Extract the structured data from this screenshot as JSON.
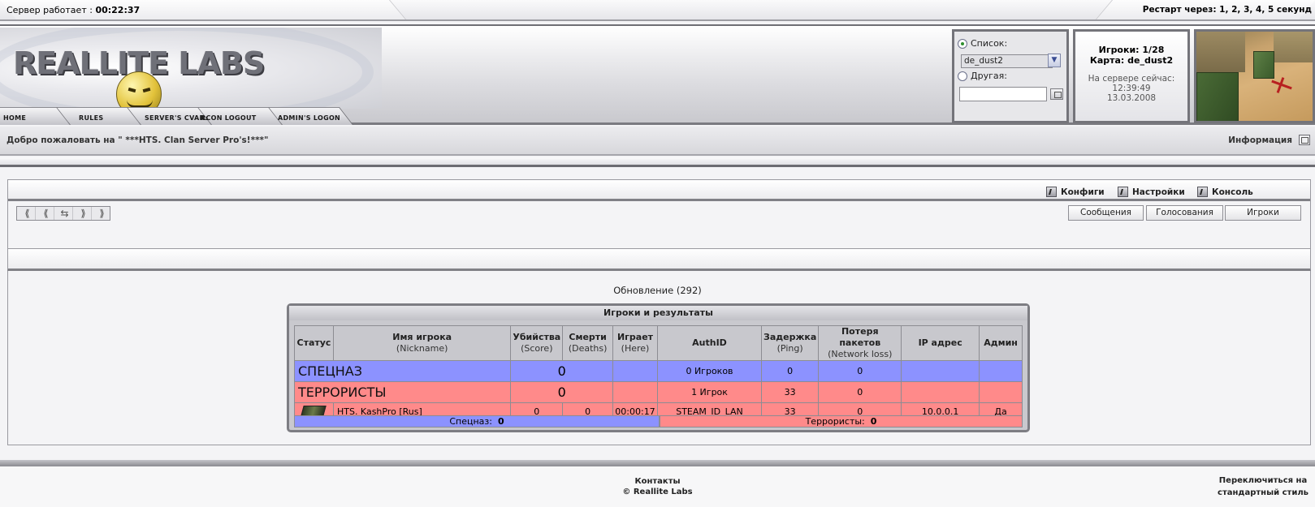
{
  "topbar": {
    "uptime_label": "Сервер работает :",
    "uptime_value": "00:22:37",
    "restart": "Рестарт через: 1, 2, 3, 4, 5 секунд"
  },
  "logo": {
    "text": "REALLITE LABS"
  },
  "nav": {
    "items": [
      "HOME",
      "RULES",
      "SERVER'S CVARS",
      "RCON LOGOUT",
      "ADMIN'S LOGON"
    ]
  },
  "mapbox": {
    "list_label": "Список:",
    "selected_map": "de_dust2",
    "other_label": "Другая:",
    "other_value": ""
  },
  "server_info": {
    "players": "Игроки: 1/28",
    "map": "Карта: de_dust2",
    "now_label": "На сервере сейчас:",
    "time": "12:39:49",
    "date": "13.03.2008"
  },
  "welcome": {
    "message": "Добро пожаловать на \" ***HTS. Clan Server Pro's!***\"",
    "info": "Информация"
  },
  "toolbar": {
    "configs": "Конфиги",
    "settings": "Настройки",
    "console": "Консоль"
  },
  "tabs": [
    "Сообщения",
    "Голосования",
    "Игроки"
  ],
  "update": "Обновление (292)",
  "players_table": {
    "caption": "Игроки и результаты",
    "headers": [
      {
        "main": "Статус",
        "sub": ""
      },
      {
        "main": "Имя игрока",
        "sub": "(Nickname)"
      },
      {
        "main": "Убийства",
        "sub": "(Score)"
      },
      {
        "main": "Смерти",
        "sub": "(Deaths)"
      },
      {
        "main": "Играет",
        "sub": "(Here)"
      },
      {
        "main": "AuthID",
        "sub": ""
      },
      {
        "main": "Задержка",
        "sub": "(Ping)"
      },
      {
        "main": "Потеря пакетов",
        "sub": "(Network loss)"
      },
      {
        "main": "IP адрес",
        "sub": ""
      },
      {
        "main": "Админ",
        "sub": ""
      }
    ],
    "ct_team": {
      "name": "СПЕЦНАЗ",
      "score": "0",
      "players": "0 Игроков",
      "ping": "0",
      "loss": "0"
    },
    "t_team": {
      "name": "ТЕРРОРИСТЫ",
      "score": "0",
      "players": "1 Игрок",
      "ping": "33",
      "loss": "0"
    },
    "player": {
      "name": "HTS. KashPro [Rus]",
      "score": "0",
      "deaths": "0",
      "time": "00:00:17",
      "authid": "STEAM_ID_LAN",
      "ping": "33",
      "loss": "0",
      "ip": "10.0.0.1",
      "admin": "Да"
    },
    "ct_total_label": "Спецназ:",
    "ct_total": "0",
    "t_total_label": "Террористы:",
    "t_total": "0"
  },
  "footer": {
    "contacts": "Контакты",
    "copyright": "© Reallite Labs",
    "switch_line1": "Переключиться на",
    "switch_line2": "стандартный стиль"
  },
  "colors": {
    "ct": "#8c92ff",
    "t": "#ff8a8a",
    "header_gray": "#c8c8cd"
  }
}
